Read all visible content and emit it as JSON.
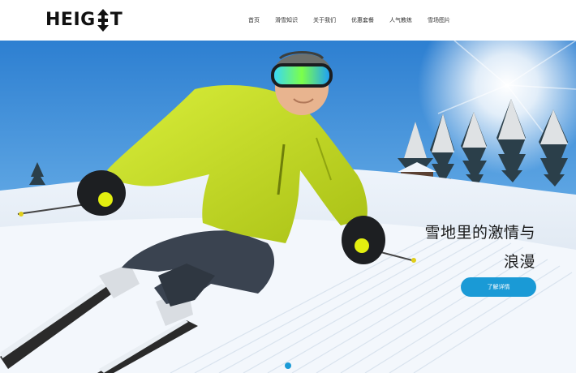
{
  "header": {
    "logo_text_left": "HEIG",
    "logo_text_right": "T",
    "nav": [
      {
        "label": "首页"
      },
      {
        "label": "滑雪知识"
      },
      {
        "label": "关于我们"
      },
      {
        "label": "优惠套餐"
      },
      {
        "label": "人气教练"
      },
      {
        "label": "雪场图片"
      }
    ]
  },
  "hero": {
    "title_line1": "雪地里的激情与",
    "title_line2": "浪漫",
    "cta_label": "了解详情"
  },
  "colors": {
    "accent": "#1a9ad6",
    "jacket": "#c6dd22",
    "sky": "#4b96d8"
  }
}
